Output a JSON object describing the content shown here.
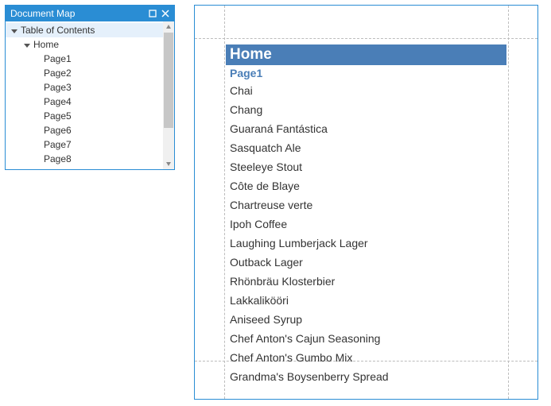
{
  "panel": {
    "title": "Document Map",
    "tree": {
      "root": {
        "label": "Table of Contents",
        "expanded": true,
        "children": [
          {
            "label": "Home",
            "expanded": true,
            "children": [
              {
                "label": "Page1"
              },
              {
                "label": "Page2"
              },
              {
                "label": "Page3"
              },
              {
                "label": "Page4"
              },
              {
                "label": "Page5"
              },
              {
                "label": "Page6"
              },
              {
                "label": "Page7"
              },
              {
                "label": "Page8"
              }
            ]
          }
        ]
      },
      "selected_path": "root"
    }
  },
  "document": {
    "heading": "Home",
    "page_link": "Page1",
    "items": [
      "Chai",
      "Chang",
      "Guaraná Fantástica",
      "Sasquatch Ale",
      "Steeleye Stout",
      "Côte de Blaye",
      "Chartreuse verte",
      "Ipoh Coffee",
      "Laughing Lumberjack Lager",
      "Outback Lager",
      "Rhönbräu Klosterbier",
      "Lakkalikööri",
      "Aniseed Syrup",
      "Chef Anton's Cajun Seasoning",
      "Chef Anton's Gumbo Mix",
      "Grandma's Boysenberry Spread"
    ]
  },
  "colors": {
    "panel_accent": "#2a8dd4",
    "doc_heading_bg": "#4a7eb7",
    "link": "#4a7eb7",
    "tree_selected_bg": "#e5f0fb"
  }
}
